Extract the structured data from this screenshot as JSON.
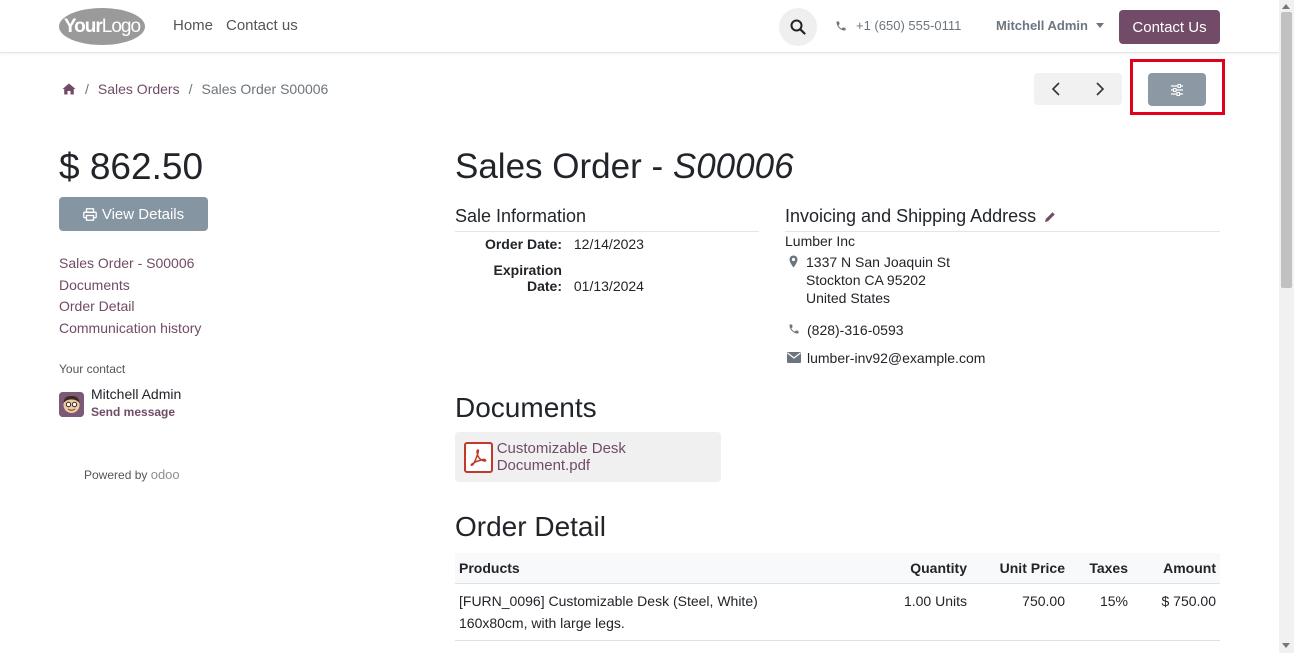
{
  "header": {
    "logo": {
      "part1": "Your",
      "part2": "Logo"
    },
    "nav": [
      "Home",
      "Contact us"
    ],
    "phone": "+1 (650) 555-0111",
    "user": "Mitchell Admin",
    "contact_button": "Contact Us"
  },
  "breadcrumb": {
    "items": [
      "Sales Orders",
      "Sales Order S00006"
    ]
  },
  "sidebar": {
    "amount": "$ 862.50",
    "view_details": "View Details",
    "nav": [
      "Sales Order - S00006",
      "Documents",
      "Order Detail",
      "Communication history"
    ],
    "contact_label": "Your contact",
    "contact_name": "Mitchell Admin",
    "send_message": "Send message",
    "powered_by": "Powered by",
    "powered_brand": "odoo"
  },
  "main": {
    "title_prefix": "Sales Order - ",
    "title_ref": "S00006",
    "sale_info": {
      "heading": "Sale Information",
      "order_date_label": "Order Date:",
      "order_date": "12/14/2023",
      "expiration_label": "Expiration Date:",
      "expiration_date": "01/13/2024"
    },
    "address": {
      "heading": "Invoicing and Shipping Address",
      "company": "Lumber Inc",
      "street": "1337 N San Joaquin St",
      "city": "Stockton CA 95202",
      "country": "United States",
      "phone": "(828)-316-0593",
      "email": "lumber-inv92@example.com"
    },
    "documents": {
      "heading": "Documents",
      "file": "Customizable Desk Document.pdf"
    },
    "order_detail": {
      "heading": "Order Detail",
      "columns": [
        "Products",
        "Quantity",
        "Unit Price",
        "Taxes",
        "Amount"
      ],
      "rows": [
        {
          "product_line1": "[FURN_0096] Customizable Desk (Steel, White)",
          "product_line2": "160x80cm, with large legs.",
          "quantity": "1.00 Units",
          "unit_price": "750.00",
          "taxes": "15%",
          "amount": "$ 750.00"
        }
      ]
    }
  },
  "colors": {
    "brand": "#714b67",
    "secondary_button": "#8595a2",
    "highlight": "#e2001a"
  }
}
